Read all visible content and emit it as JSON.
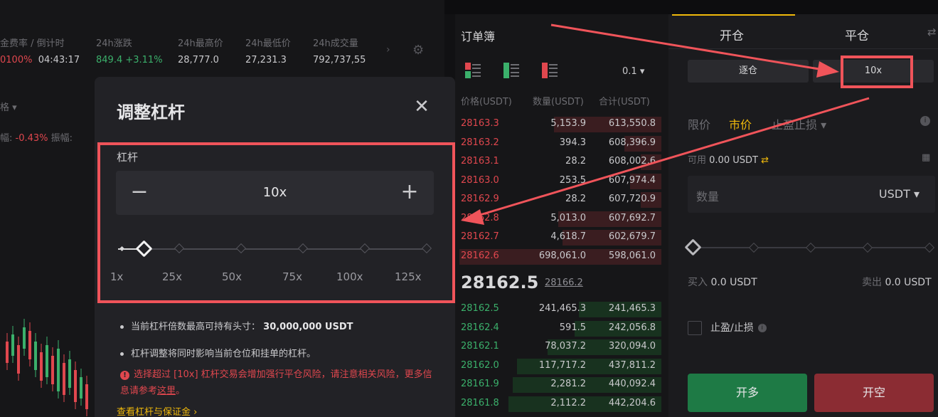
{
  "ticker": {
    "cols": [
      {
        "label": "金费率 / 倒计时",
        "value_a": "0100%",
        "value_b": "04:43:17"
      },
      {
        "label": "24h涨跌",
        "value_a": "849.4",
        "value_b": "+3.11%"
      },
      {
        "label": "24h最高价",
        "value": "28,777.0"
      },
      {
        "label": "24h最低价",
        "value": "27,231.3"
      },
      {
        "label": "24h成交量",
        "value": "792,737,55"
      }
    ],
    "row2_label": "格",
    "row3_label": "幅:",
    "row3_value": "-0.43%",
    "row3_label2": "振幅:"
  },
  "modal": {
    "title": "调整杠杆",
    "close_icon": "close-icon",
    "leverage_label": "杠杆",
    "leverage_value": "10x",
    "leverage_fraction": 0.0741,
    "marks": [
      "1x",
      "25x",
      "50x",
      "75x",
      "100x",
      "125x"
    ],
    "info1_text": "当前杠杆倍数最高可持有头寸：",
    "info1_value": "30,000,000 USDT",
    "info2_text": "杠杆调整将同时影响当前仓位和挂单的杠杆。",
    "warning_text": "选择超过 [10x] 杠杆交易会增加强行平仓风险，请注意相关风险，更多信息请参考",
    "warning_link": "这里",
    "warning_end": "。",
    "margin_link": "查看杠杆与保证金 ›"
  },
  "orderbook": {
    "title": "订单簿",
    "precision": "0.1",
    "headers": [
      "价格(USDT)",
      "数量(USDT)",
      "合计(USDT)"
    ],
    "asks": [
      {
        "price": "28163.3",
        "qty": "5,153.9",
        "total": "613,550.8",
        "depth": 0.52
      },
      {
        "price": "28163.2",
        "qty": "394.3",
        "total": "608,396.9",
        "depth": 0.18
      },
      {
        "price": "28163.1",
        "qty": "28.2",
        "total": "608,002.6",
        "depth": 0.1
      },
      {
        "price": "28163.0",
        "qty": "253.5",
        "total": "607,974.4",
        "depth": 0.15
      },
      {
        "price": "28162.9",
        "qty": "28.2",
        "total": "607,720.9",
        "depth": 0.1
      },
      {
        "price": "28162.8",
        "qty": "5,013.0",
        "total": "607,692.7",
        "depth": 0.5
      },
      {
        "price": "28162.7",
        "qty": "4,618.7",
        "total": "602,679.7",
        "depth": 0.48
      },
      {
        "price": "28162.6",
        "qty": "698,061.0",
        "total": "598,061.0",
        "depth": 0.98
      }
    ],
    "last_price": "28162.5",
    "mark_price": "28166.2",
    "bids": [
      {
        "price": "28162.5",
        "qty": "241,465.3",
        "total": "241,465.3",
        "depth": 0.4
      },
      {
        "price": "28162.4",
        "qty": "591.5",
        "total": "242,056.8",
        "depth": 0.42
      },
      {
        "price": "28162.1",
        "qty": "78,037.2",
        "total": "320,094.0",
        "depth": 0.55
      },
      {
        "price": "28162.0",
        "qty": "117,717.2",
        "total": "437,811.2",
        "depth": 0.7
      },
      {
        "price": "28161.9",
        "qty": "2,281.2",
        "total": "440,092.4",
        "depth": 0.72
      },
      {
        "price": "28161.8",
        "qty": "2,112.2",
        "total": "442,204.6",
        "depth": 0.74
      }
    ]
  },
  "trade": {
    "tab_open": "开仓",
    "tab_close": "平仓",
    "margin_mode": "逐仓",
    "leverage": "10x",
    "order_types": [
      "限价",
      "市价",
      "止盈止损 ▾"
    ],
    "available_label": "可用",
    "available_value": "0.00 USDT",
    "qty_placeholder": "数量",
    "qty_unit": "USDT ▾",
    "buy_label": "买入",
    "buy_value": "0.0 USDT",
    "sell_label": "卖出",
    "sell_value": "0.0 USDT",
    "tpsl_label": "止盈/止损",
    "open_long": "开多",
    "open_short": "开空"
  },
  "colors": {
    "accent": "#f0b90b",
    "ask": "#e0474e",
    "bid": "#3bb06b",
    "highlight": "#f0545a"
  }
}
